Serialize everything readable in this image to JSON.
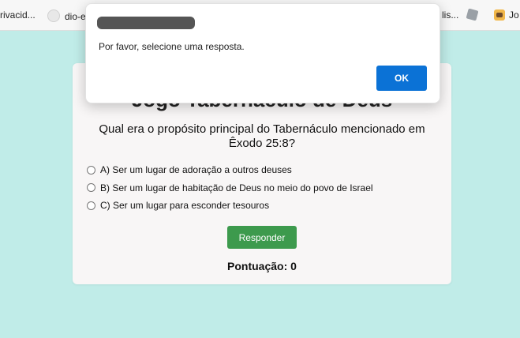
{
  "bookmarks": [
    {
      "label": "rivacid..."
    },
    {
      "label": "dio-e",
      "icon": "github-icon"
    },
    {
      "label": "lis..."
    },
    {
      "label": "",
      "icon": "roblox-icon"
    },
    {
      "label": "Jo",
      "icon": "emoji-avatar-icon"
    }
  ],
  "game": {
    "title": "Jogo Tabernáculo de Deus",
    "question": "Qual era o propósito principal do Tabernáculo mencionado em Êxodo 25:8?",
    "options": [
      {
        "label": "A) Ser um lugar de adoração a outros deuses"
      },
      {
        "label": "B) Ser um lugar de habitação de Deus no meio do povo de Israel"
      },
      {
        "label": "C) Ser um lugar para esconder tesouros"
      }
    ],
    "submit_label": "Responder",
    "score_label": "Pontuação:",
    "score_value": "0"
  },
  "alert": {
    "message": "Por favor, selecione uma resposta.",
    "ok_label": "OK"
  },
  "colors": {
    "page_background": "#c0ece8",
    "submit_button": "#3d9a4d",
    "ok_button": "#0b72d6"
  }
}
